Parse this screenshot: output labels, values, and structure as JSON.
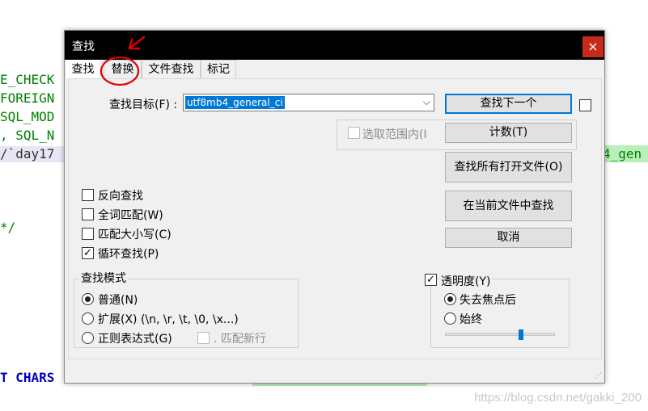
{
  "background_code": {
    "lines": [
      "E_CHECK",
      "FOREIGN",
      "SQL_MOD",
      ", SQL_N",
      "/`day17",
      "*/",
      "T CHARS"
    ],
    "right_fragment": "4_gen"
  },
  "watermark": "https://blog.csdn.net/gakki_200",
  "dialog": {
    "title": "查找",
    "close_label": "×",
    "tabs": [
      "查找",
      "替换",
      "文件查找",
      "标记"
    ],
    "find_label": "查找目标(F) :",
    "find_value": "utf8mb4_general_ci",
    "combo_arrow": "⌵",
    "in_selection": "选取范围内(I",
    "buttons": {
      "find_next": "查找下一个",
      "count": "计数(T)",
      "find_all_open": "查找所有打开文件(O)",
      "find_in_current": "在当前文件中查找",
      "cancel": "取消"
    },
    "options": {
      "backward": "反向查找",
      "whole_word": "全词匹配(W)",
      "match_case": "匹配大小写(C)",
      "wrap": "循环查找(P)"
    },
    "checkmark": "✓",
    "search_mode": {
      "title": "查找模式",
      "normal": "普通(N)",
      "extended": "扩展(X) (\\n, \\r, \\t, \\0, \\x...)",
      "regex": "正则表达式(G)",
      "dot_newline": ". 匹配新行"
    },
    "transparency": {
      "title": "透明度(Y)",
      "on_lose_focus": "失去焦点后",
      "always": "始终",
      "level": 0.7
    }
  },
  "annotation_color": "#e00000",
  "accent": "#0078d7"
}
